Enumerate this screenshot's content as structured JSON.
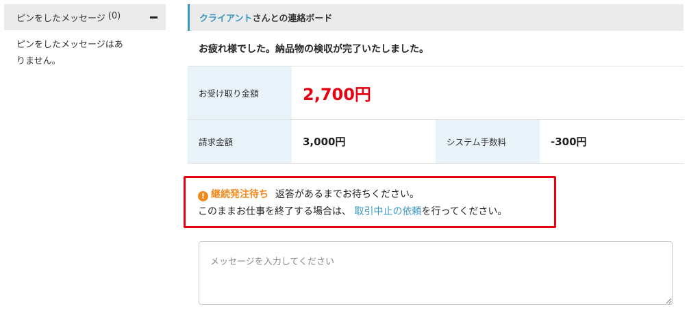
{
  "sidebar": {
    "pin_header": {
      "title": "ピンをしたメッセージ",
      "count": "(0)"
    },
    "pin_empty": "ピンをしたメッセージはありません。"
  },
  "board": {
    "client_name": "クライアント",
    "title_suffix": "さんとの連絡ボード",
    "notice": "お疲れ様でした。納品物の検収が完了いたしました。"
  },
  "amounts": {
    "receive_label": "お受け取り金額",
    "receive_value": "2,700円",
    "invoice_label": "請求金額",
    "invoice_value": "3,000円",
    "fee_label": "システム手数料",
    "fee_value": "-300円"
  },
  "alert": {
    "status_label": "継続発注待ち",
    "status_message": "返答があるまでお待ちください。",
    "line2_prefix": "このままお仕事を終了する場合は、",
    "link_text": "取引中止の依頼",
    "line2_suffix": "を行ってください。"
  },
  "message_input": {
    "placeholder": "メッセージを入力してください",
    "value": ""
  },
  "colors": {
    "accent": "#3a97c2",
    "alert_border": "#e60012",
    "amount_red": "#e60012",
    "status_orange": "#f08a1c",
    "label_bg": "#e8f3fa"
  }
}
